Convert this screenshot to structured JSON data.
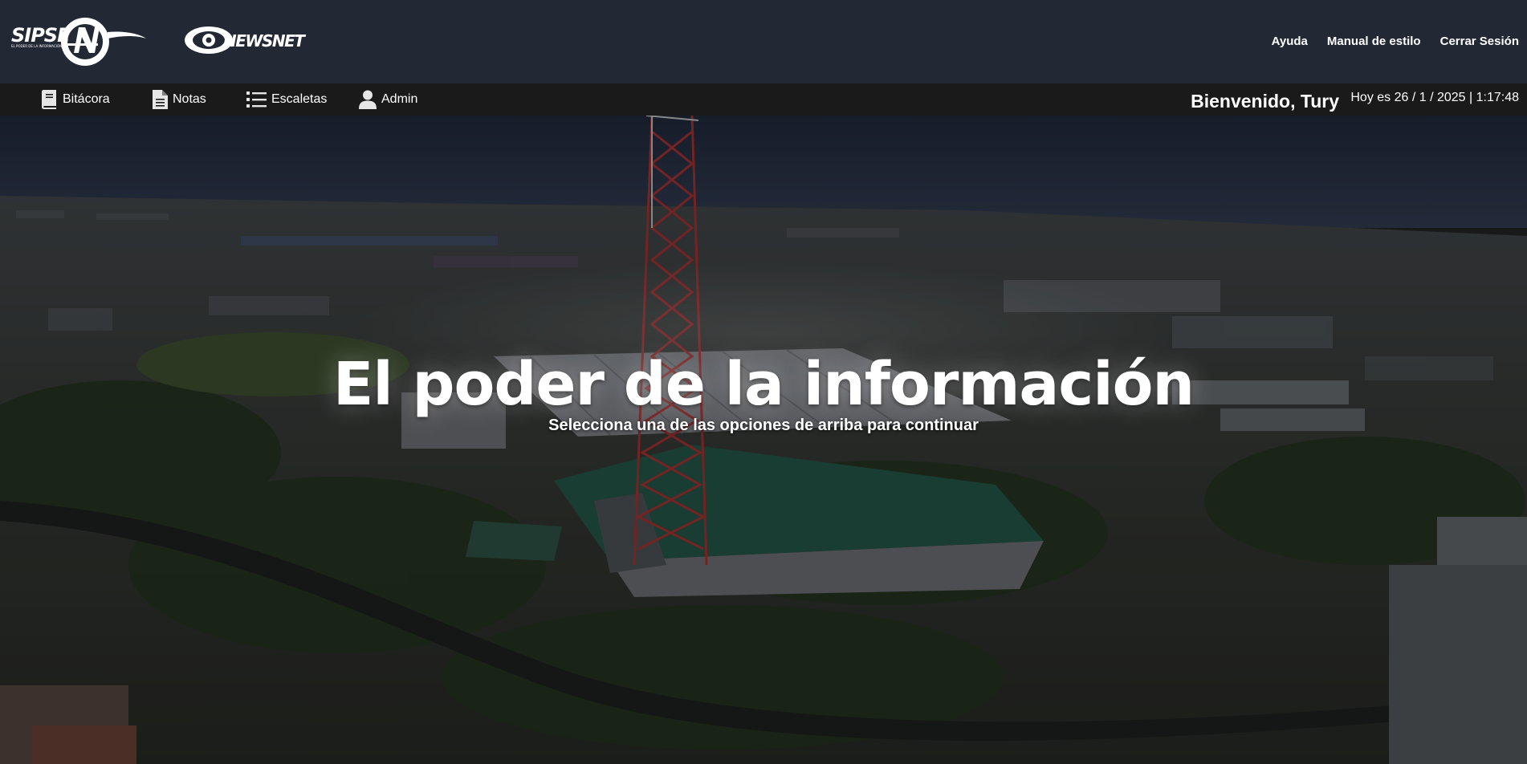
{
  "header": {
    "logo_primary": "SIPSE",
    "logo_primary_tagline": "EL PODER DE LA INFORMACIÓN",
    "logo_secondary": "NEWSNET",
    "links": [
      {
        "label": "Ayuda"
      },
      {
        "label": "Manual de estilo"
      },
      {
        "label": "Cerrar Sesión"
      }
    ]
  },
  "nav": {
    "items": [
      {
        "label": "Bitácora",
        "icon": "book-icon"
      },
      {
        "label": "Notas",
        "icon": "document-icon"
      },
      {
        "label": "Escaletas",
        "icon": "list-icon"
      },
      {
        "label": "Admin",
        "icon": "user-icon"
      }
    ],
    "welcome": "Bienvenido, Tury",
    "datetime": "Hoy es 26 / 1 / 2025 | 1:17:48"
  },
  "hero": {
    "title": "El poder de la información",
    "subtitle": "Selecciona una de las opciones de arriba para continuar"
  },
  "colors": {
    "header_bg": "#232835",
    "nav_bg": "#1a1a1a",
    "text": "#ffffff"
  }
}
